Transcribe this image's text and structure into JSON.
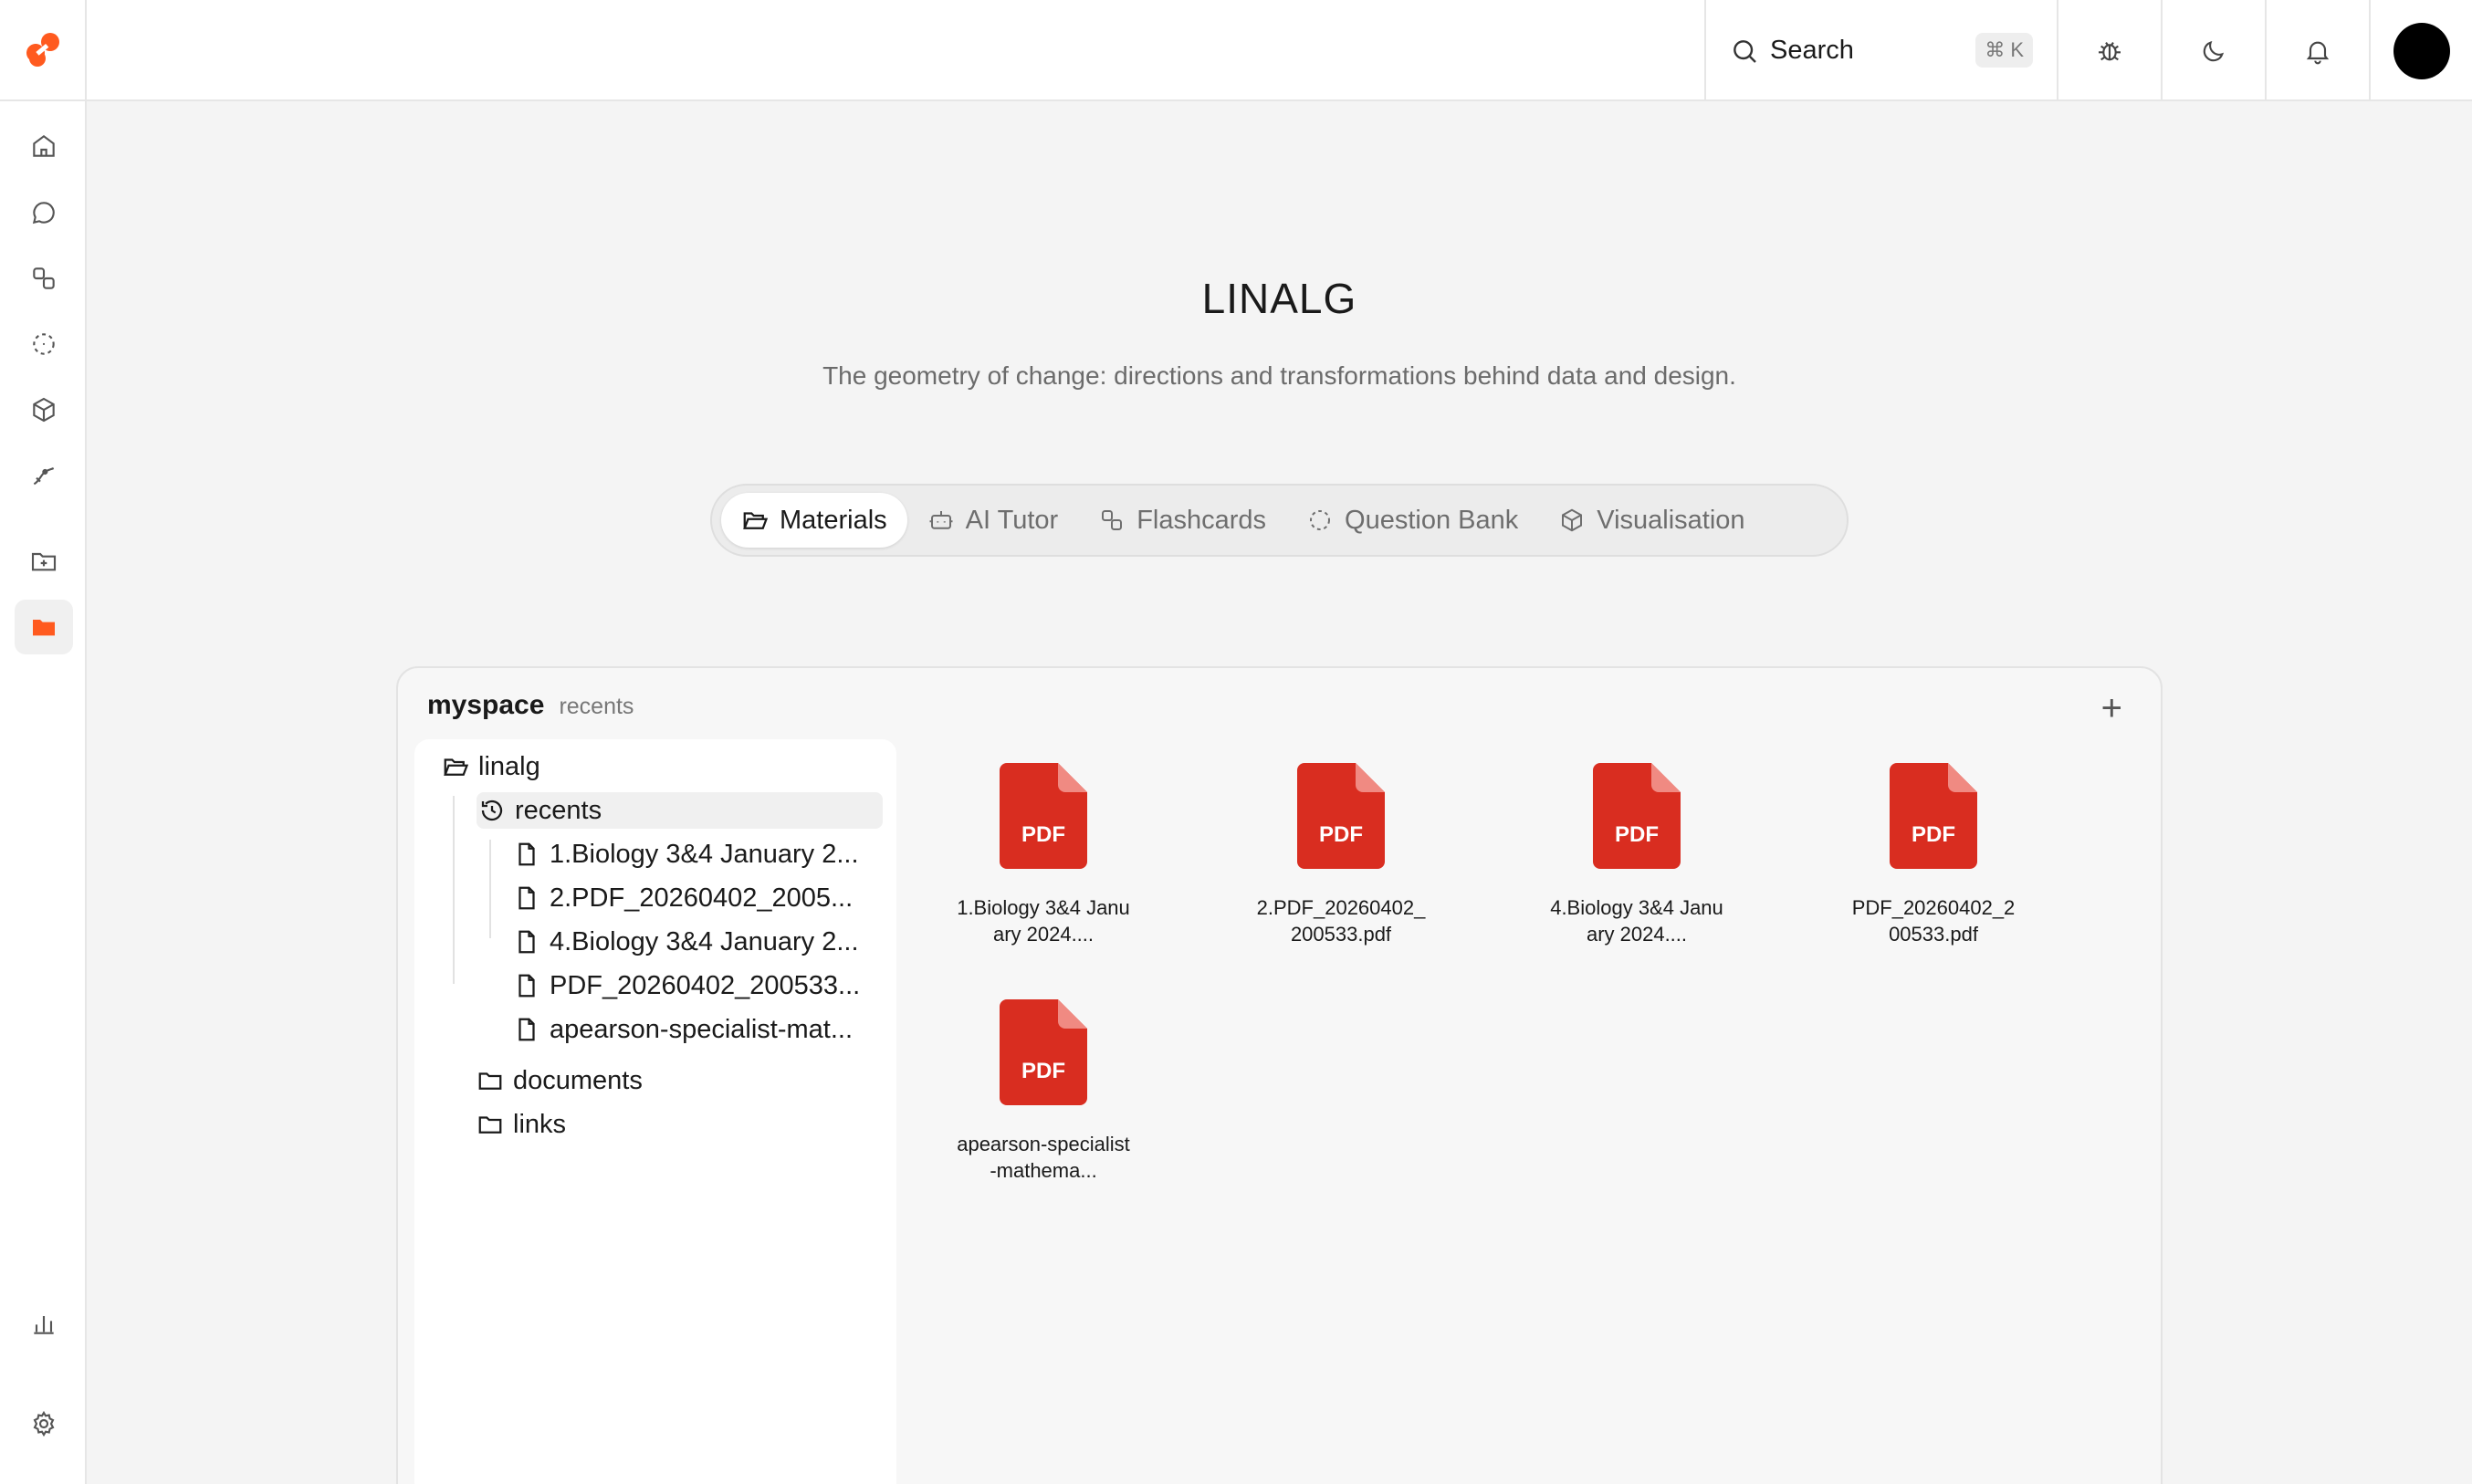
{
  "topbar": {
    "search_label": "Search",
    "search_kbd_symbol": "⌘",
    "search_kbd_key": "K"
  },
  "sidebar": {
    "items": [
      {
        "icon": "home-icon"
      },
      {
        "icon": "chat-icon"
      },
      {
        "icon": "flashcards-icon"
      },
      {
        "icon": "question-bank-icon"
      },
      {
        "icon": "cube-icon"
      },
      {
        "icon": "graph-icon"
      },
      {
        "icon": "new-folder-icon"
      },
      {
        "icon": "folder-icon",
        "active": true
      }
    ],
    "bottom": [
      {
        "icon": "chart-icon"
      },
      {
        "icon": "settings-icon"
      }
    ]
  },
  "page": {
    "title": "LINALG",
    "subtitle": "The geometry of change: directions and transformations behind data and design."
  },
  "tabs": [
    {
      "label": "Materials",
      "icon": "folder-open-icon",
      "active": true
    },
    {
      "label": "AI Tutor",
      "icon": "robot-icon"
    },
    {
      "label": "Flashcards",
      "icon": "flashcards-icon"
    },
    {
      "label": "Question Bank",
      "icon": "question-bank-icon"
    },
    {
      "label": "Visualisation",
      "icon": "cube-icon"
    }
  ],
  "panel": {
    "space": "myspace",
    "crumb": "recents",
    "add_symbol": "+"
  },
  "tree": {
    "root": "linalg",
    "recents": "recents",
    "recent_files": [
      "1.Biology 3&4 January 2...",
      "2.PDF_20260402_2005...",
      "4.Biology 3&4 January 2...",
      "PDF_20260402_200533...",
      "apearson-specialist-mat..."
    ],
    "documents": "documents",
    "links": "links"
  },
  "files": [
    {
      "name": "1.Biology 3&4 January 2024....",
      "badge": "PDF"
    },
    {
      "name": "2.PDF_20260402_200533.pdf",
      "badge": "PDF"
    },
    {
      "name": "4.Biology 3&4 January 2024....",
      "badge": "PDF"
    },
    {
      "name": "PDF_20260402_200533.pdf",
      "badge": "PDF"
    },
    {
      "name": "apearson-specialist-mathema...",
      "badge": "PDF"
    }
  ],
  "colors": {
    "brand": "#ff5a1f",
    "pdf_red": "#d92d20"
  }
}
